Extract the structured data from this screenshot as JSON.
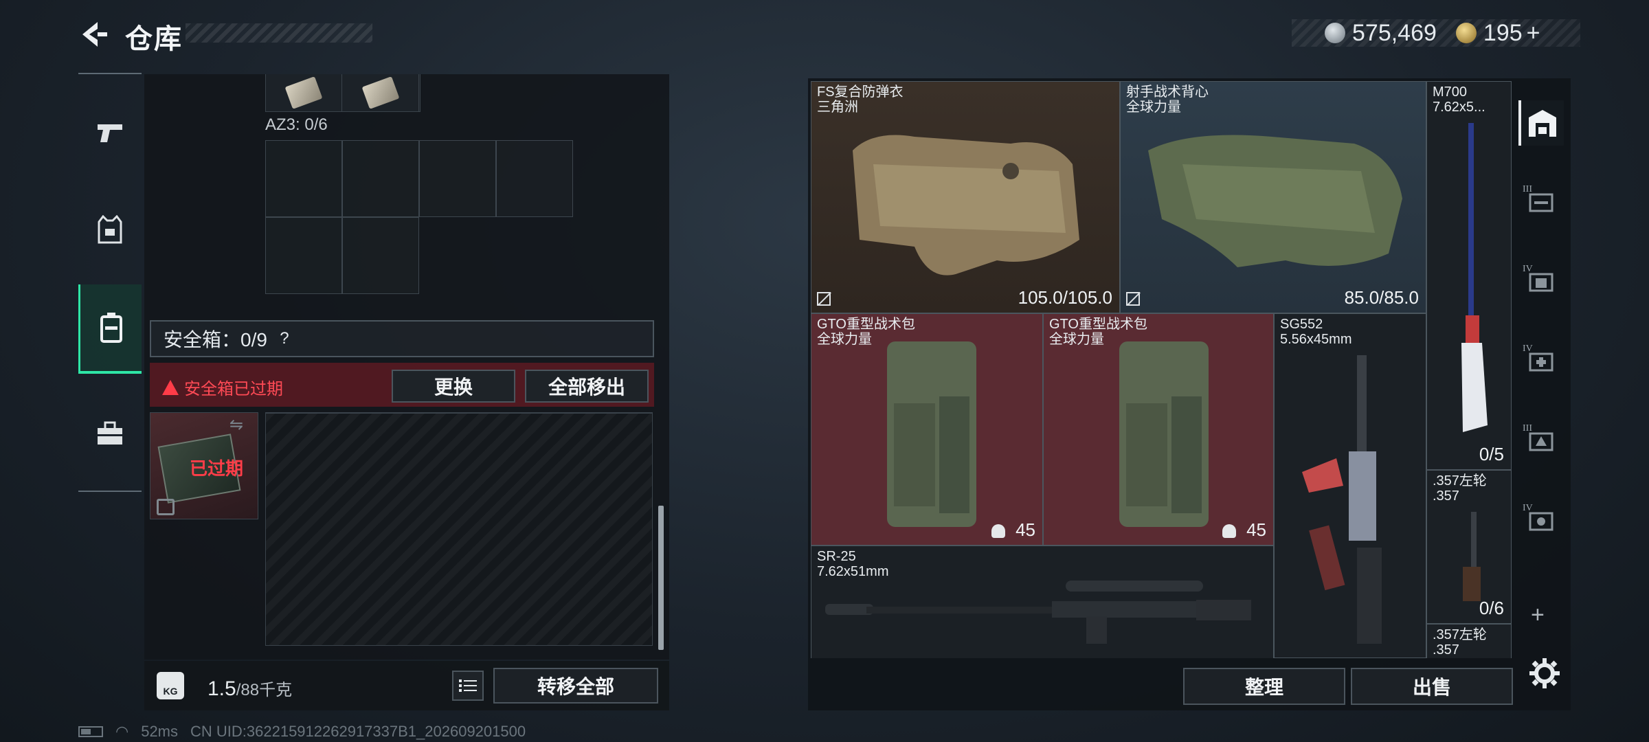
{
  "header": {
    "title": "仓库"
  },
  "currency": {
    "silver": "575,469",
    "gold": "195",
    "plus": "+"
  },
  "left_nav": {
    "items": [
      {
        "name": "weapons",
        "icon": "pistol-icon"
      },
      {
        "name": "equipment",
        "icon": "vest-icon"
      },
      {
        "name": "safe-box",
        "icon": "safe-box-icon",
        "active": true
      },
      {
        "name": "toolbox",
        "icon": "toolbox-icon"
      }
    ]
  },
  "container": {
    "az3_label": "AZ3: 0/6",
    "safe_box_label": "安全箱：0/9",
    "safe_help": "?",
    "expired_message": "安全箱已过期",
    "replace_button": "更换",
    "move_out_all_button": "全部移出",
    "thumb_expired_label": "已过期"
  },
  "footer_left": {
    "kg_icon": "KG",
    "weight_current": "1.5",
    "weight_max": "/88千克",
    "transfer_all_button": "转移全部"
  },
  "status_bar": {
    "ping": "52ms",
    "uid": "CN UID:362215912262917337B1_202609201500"
  },
  "storage": {
    "items": [
      {
        "id": "fs-vest",
        "name_line1": "FS复合防弹衣",
        "name_line2": "三角洲",
        "value": "105.0/105.0"
      },
      {
        "id": "shooter-vest",
        "name_line1": "射手战术背心",
        "name_line2": "全球力量",
        "value": "85.0/85.0"
      },
      {
        "id": "m700",
        "name_line1": "M700",
        "name_line2": "7.62x5...",
        "value": "0/5"
      },
      {
        "id": "gto1",
        "name_line1": "GTO重型战术包",
        "name_line2": "全球力量",
        "value": "45"
      },
      {
        "id": "gto2",
        "name_line1": "GTO重型战术包",
        "name_line2": "全球力量",
        "value": "45"
      },
      {
        "id": "sg552",
        "name_line1": "SG552",
        "name_line2": "5.56x45mm",
        "value": ""
      },
      {
        "id": "357a",
        "name_line1": ".357左轮",
        "name_line2": ".357",
        "value": "0/6"
      },
      {
        "id": "357b",
        "name_line1": ".357左轮",
        "name_line2": ".357",
        "value": ""
      },
      {
        "id": "sr25",
        "name_line1": "SR-25",
        "name_line2": "7.62x51mm",
        "value": ""
      }
    ],
    "sort_button": "整理",
    "sell_button": "出售"
  },
  "right_nav": {
    "items": [
      {
        "roman": "",
        "icon": "warehouse-icon",
        "active": true
      },
      {
        "roman": "III",
        "icon": "weapon-storage-icon"
      },
      {
        "roman": "IV",
        "icon": "equipment-storage-icon"
      },
      {
        "roman": "IV",
        "icon": "medical-storage-icon"
      },
      {
        "roman": "III",
        "icon": "ammo-storage-icon"
      },
      {
        "roman": "IV",
        "icon": "misc-storage-icon"
      }
    ],
    "add": "+"
  },
  "colors": {
    "accent": "#2ee6a6",
    "alert": "#ff3c48",
    "bag_tile": "#5a2b32"
  }
}
